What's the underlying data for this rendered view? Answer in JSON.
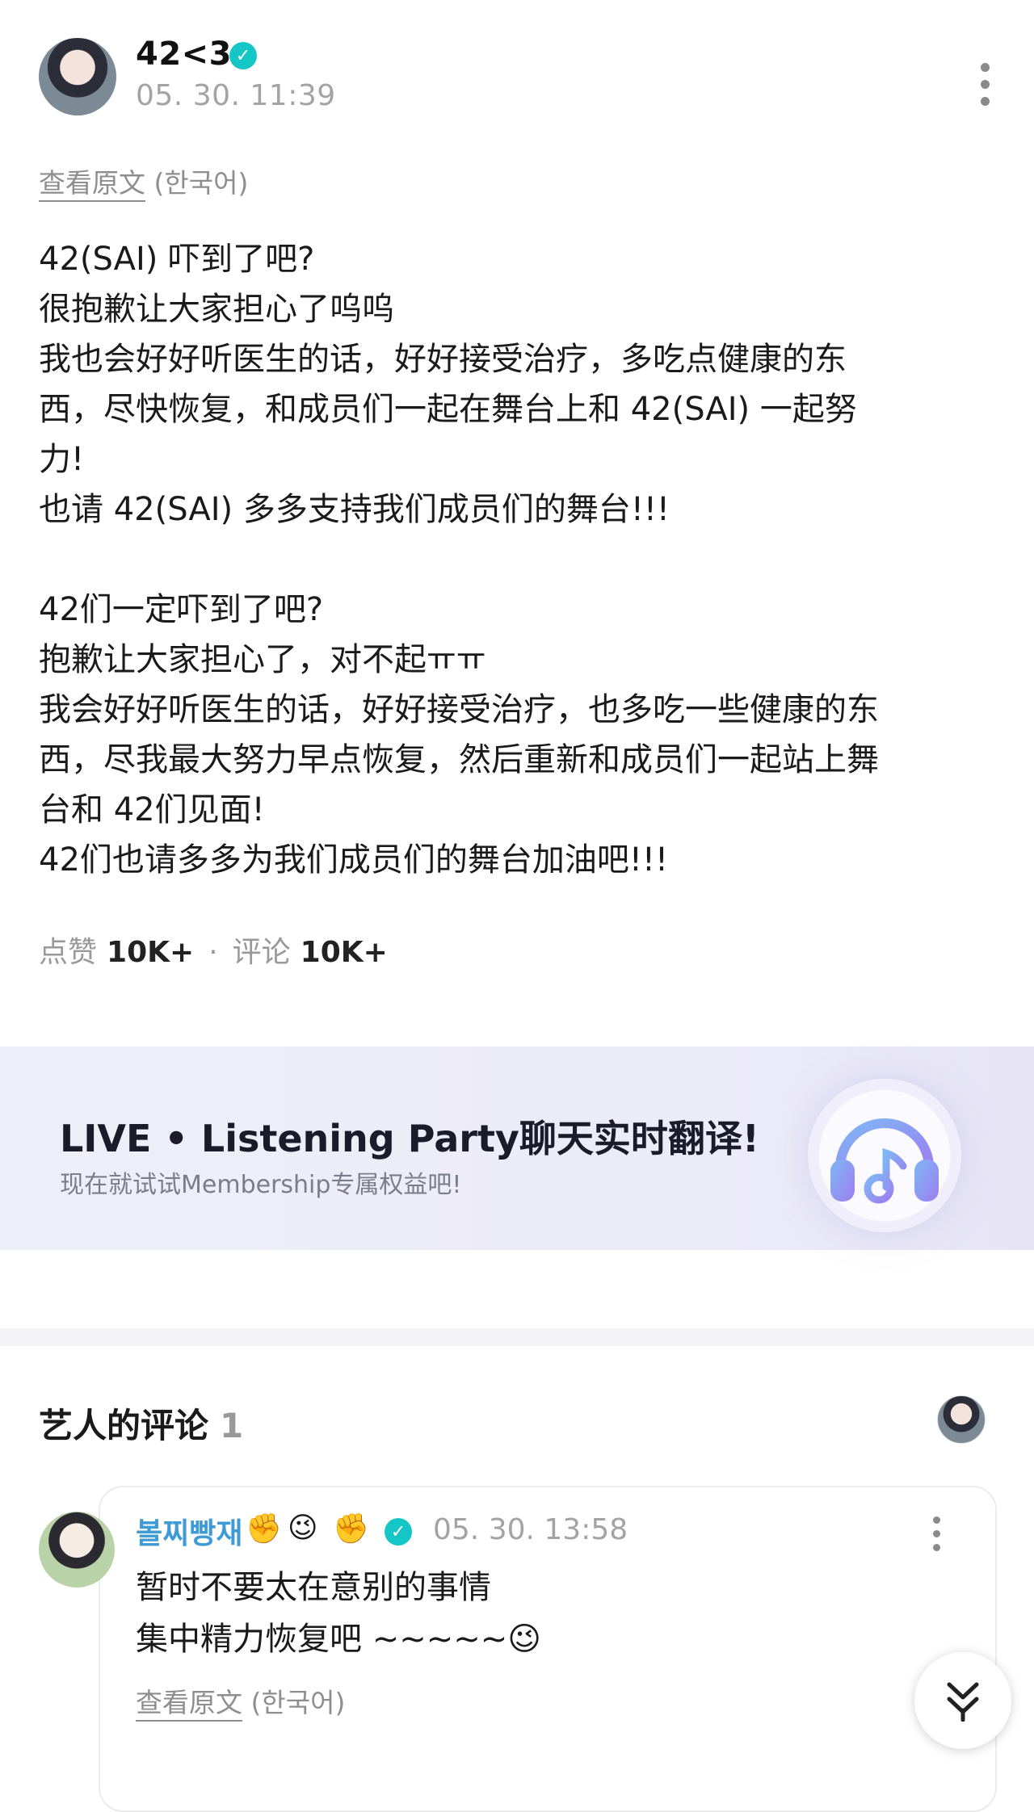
{
  "header": {
    "username": "42<3",
    "timestamp": "05. 30. 11:39"
  },
  "post": {
    "view_original_link": "查看原文",
    "view_original_lang": "(한국어)",
    "body": "42(SAI) 吓到了吧?\n很抱歉让大家担心了呜呜\n我也会好好听医生的话，好好接受治疗，多吃点健康的东\n西，尽快恢复，和成员们一起在舞台上和 42(SAI) 一起努\n力!\n也请 42(SAI) 多多支持我们成员们的舞台!!!\n\n42们一定吓到了吧?\n抱歉让大家担心了，对不起ㅠㅠ\n我会好好听医生的话，好好接受治疗，也多吃一些健康的东\n西，尽我最大努力早点恢复，然后重新和成员们一起站上舞\n台和 42们见面!\n42们也请多多为我们成员们的舞台加油吧!!!",
    "likes_label": "点赞",
    "likes_count": "10K+",
    "comments_label": "评论",
    "comments_count": "10K+"
  },
  "banner": {
    "title": "LIVE • Listening Party聊天实时翻译!",
    "subtitle": "现在就试试Membership专属权益吧!",
    "icon": "headphones-music-icon"
  },
  "comments": {
    "title": "艺人的评论",
    "count": "1",
    "items": [
      {
        "author": "볼찌빵재",
        "time": "05. 30. 13:58",
        "text": "暂时不要太在意别的事情\n集中精力恢复吧 ~~~~~😉",
        "view_original_link": "查看原文",
        "view_original_lang": "(한국어)"
      }
    ]
  },
  "colors": {
    "verified": "#14c6c6",
    "comment_author": "#3f9bd6",
    "muted": "#a3a3a3",
    "headphone": "#8f7fe8"
  }
}
